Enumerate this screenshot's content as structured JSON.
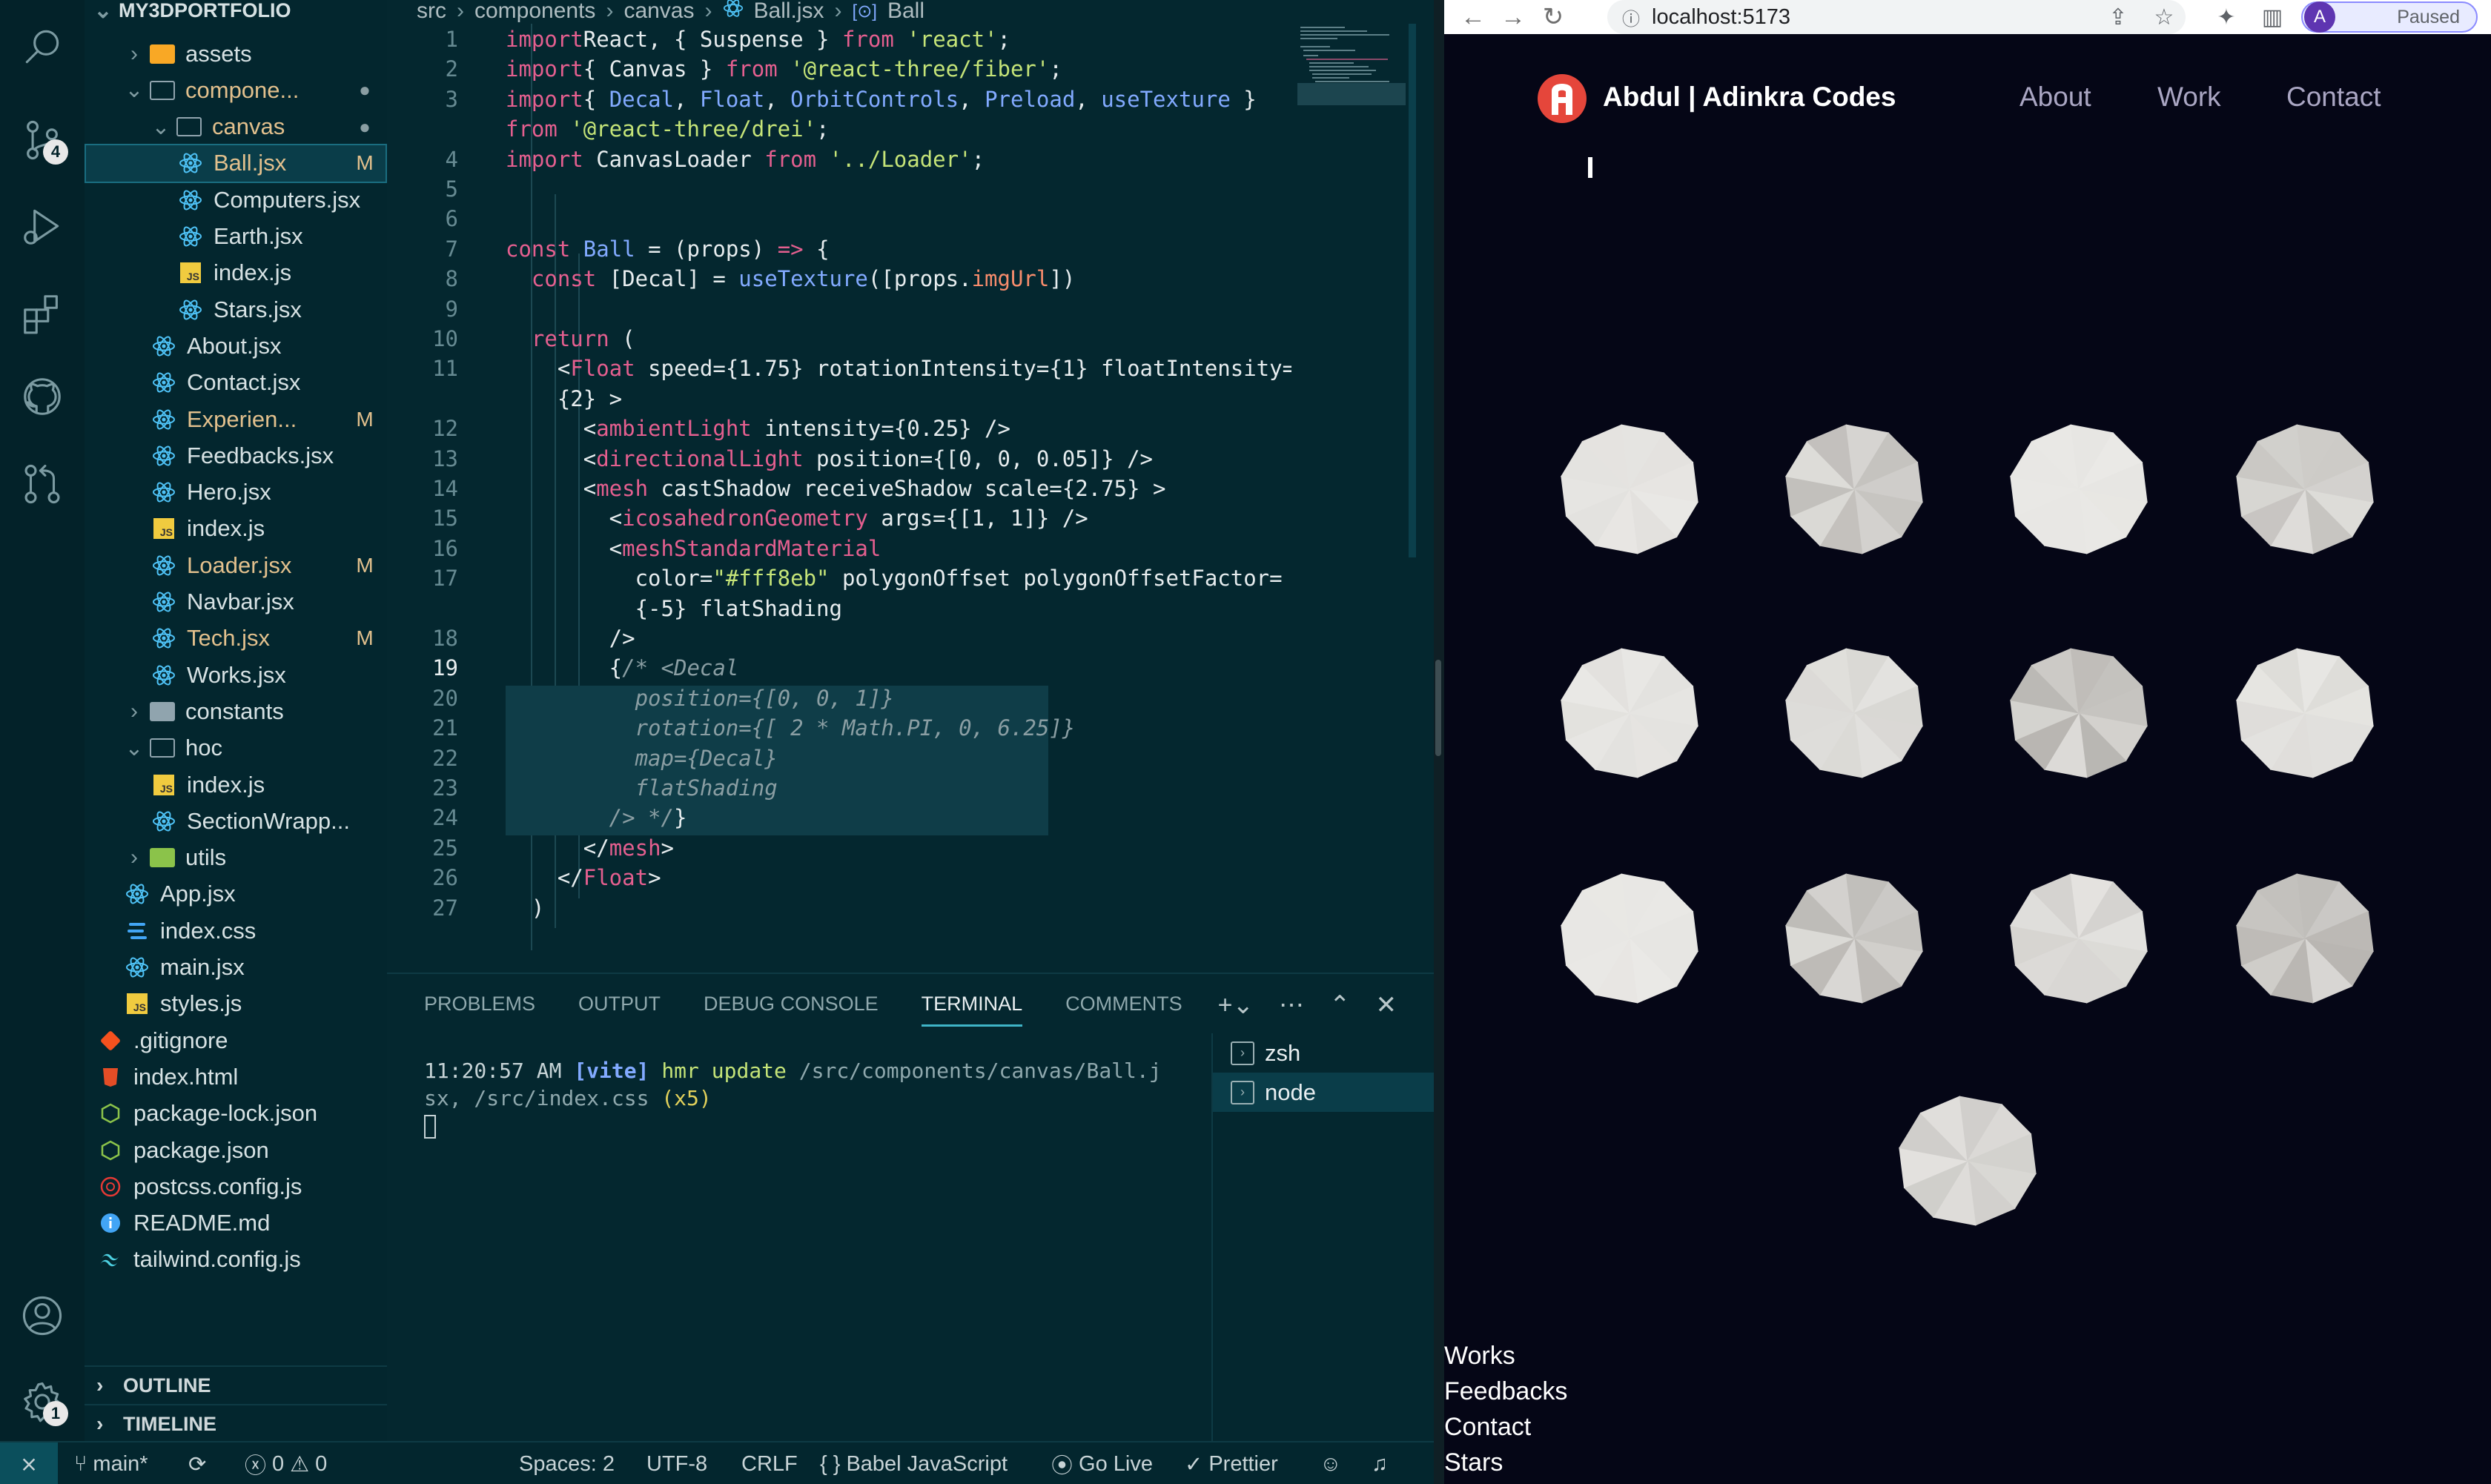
{
  "editor": {
    "breadcrumbs": [
      "src",
      "components",
      "canvas",
      "Ball.jsx",
      "Ball"
    ],
    "activity_badges": {
      "scm": "4",
      "settings": "1"
    }
  },
  "explorer": {
    "root": "MY3DPORTFOLIO",
    "tree": [
      {
        "name": "assets",
        "kind": "folder",
        "depth": 1,
        "chevron": "›"
      },
      {
        "name": "compone...",
        "kind": "folder-open",
        "depth": 1,
        "chevron": "⌄",
        "status": "●",
        "modified": true
      },
      {
        "name": "canvas",
        "kind": "folder-open",
        "depth": 2,
        "chevron": "⌄",
        "status": "●",
        "modified": true
      },
      {
        "name": "Ball.jsx",
        "kind": "react",
        "depth": 3,
        "status": "M",
        "modified": true,
        "selected": true
      },
      {
        "name": "Computers.jsx",
        "kind": "react",
        "depth": 3
      },
      {
        "name": "Earth.jsx",
        "kind": "react",
        "depth": 3
      },
      {
        "name": "index.js",
        "kind": "js",
        "depth": 3
      },
      {
        "name": "Stars.jsx",
        "kind": "react",
        "depth": 3
      },
      {
        "name": "About.jsx",
        "kind": "react",
        "depth": 2
      },
      {
        "name": "Contact.jsx",
        "kind": "react",
        "depth": 2
      },
      {
        "name": "Experien...",
        "kind": "react",
        "depth": 2,
        "status": "M",
        "modified": true
      },
      {
        "name": "Feedbacks.jsx",
        "kind": "react",
        "depth": 2
      },
      {
        "name": "Hero.jsx",
        "kind": "react",
        "depth": 2
      },
      {
        "name": "index.js",
        "kind": "js",
        "depth": 2
      },
      {
        "name": "Loader.jsx",
        "kind": "react",
        "depth": 2,
        "status": "M",
        "modified": true
      },
      {
        "name": "Navbar.jsx",
        "kind": "react",
        "depth": 2
      },
      {
        "name": "Tech.jsx",
        "kind": "react",
        "depth": 2,
        "status": "M",
        "modified": true
      },
      {
        "name": "Works.jsx",
        "kind": "react",
        "depth": 2
      },
      {
        "name": "constants",
        "kind": "folder",
        "depth": 1,
        "chevron": "›"
      },
      {
        "name": "hoc",
        "kind": "folder-open",
        "depth": 1,
        "chevron": "⌄"
      },
      {
        "name": "index.js",
        "kind": "js",
        "depth": 2
      },
      {
        "name": "SectionWrapp...",
        "kind": "react",
        "depth": 2
      },
      {
        "name": "utils",
        "kind": "folder",
        "depth": 1,
        "chevron": "›"
      },
      {
        "name": "App.jsx",
        "kind": "react",
        "depth": 1
      },
      {
        "name": "index.css",
        "kind": "css",
        "depth": 1
      },
      {
        "name": "main.jsx",
        "kind": "react",
        "depth": 1
      },
      {
        "name": "styles.js",
        "kind": "js",
        "depth": 1
      },
      {
        "name": ".gitignore",
        "kind": "git",
        "depth": 0
      },
      {
        "name": "index.html",
        "kind": "html",
        "depth": 0
      },
      {
        "name": "package-lock.json",
        "kind": "npm",
        "depth": 0
      },
      {
        "name": "package.json",
        "kind": "npm",
        "depth": 0
      },
      {
        "name": "postcss.config.js",
        "kind": "postcss",
        "depth": 0
      },
      {
        "name": "README.md",
        "kind": "info",
        "depth": 0
      },
      {
        "name": "tailwind.config.js",
        "kind": "tailwind",
        "depth": 0
      }
    ],
    "outline": "OUTLINE",
    "timeline": "TIMELINE"
  },
  "code": [
    {
      "n": "1",
      "tokens": [
        [
          "k",
          "import"
        ],
        [
          "",
          "React, { Suspense } "
        ],
        [
          "k",
          "from"
        ],
        [
          "s",
          " 'react'"
        ],
        [
          "",
          ";"
        ]
      ]
    },
    {
      "n": "2",
      "tokens": [
        [
          "k",
          "import"
        ],
        [
          "",
          ""
        ],
        [
          "",
          "{ Canvas } "
        ],
        [
          "k",
          "from"
        ],
        [
          "s",
          " '@react-three/fiber'"
        ],
        [
          "",
          ";"
        ]
      ]
    },
    {
      "n": "3",
      "tokens": [
        [
          "k",
          "import"
        ],
        [
          "",
          "{ "
        ],
        [
          "v",
          "Decal"
        ],
        [
          "",
          ", "
        ],
        [
          "v",
          "Float"
        ],
        [
          "",
          ", "
        ],
        [
          "v",
          "OrbitControls"
        ],
        [
          "",
          ", "
        ],
        [
          "v",
          "Preload"
        ],
        [
          "",
          ", "
        ],
        [
          "v",
          "useTexture"
        ],
        [
          "",
          " }"
        ]
      ]
    },
    {
      "n": "",
      "tokens": [
        [
          "k",
          "from"
        ],
        [
          "s",
          " '@react-three/drei'"
        ],
        [
          "",
          ";"
        ]
      ]
    },
    {
      "n": "4",
      "tokens": [
        [
          "k",
          "import"
        ],
        [
          "",
          " CanvasLoader "
        ],
        [
          "k",
          "from"
        ],
        [
          "s",
          " '../Loader'"
        ],
        [
          "",
          ";"
        ]
      ]
    },
    {
      "n": "5",
      "tokens": []
    },
    {
      "n": "6",
      "tokens": []
    },
    {
      "n": "7",
      "tokens": [
        [
          "k",
          "const"
        ],
        [
          "v",
          " Ball"
        ],
        [
          "",
          " = (props) "
        ],
        [
          "k",
          "=>"
        ],
        [
          "",
          " {"
        ]
      ]
    },
    {
      "n": "8",
      "tokens": [
        [
          "",
          "  "
        ],
        [
          "k",
          "const"
        ],
        [
          "",
          " [Decal] = "
        ],
        [
          "v",
          "useTexture"
        ],
        [
          "",
          "([props."
        ],
        [
          "n",
          "imgUrl"
        ],
        [
          "",
          "])"
        ]
      ]
    },
    {
      "n": "9",
      "tokens": []
    },
    {
      "n": "10",
      "tokens": [
        [
          "",
          "  "
        ],
        [
          "k",
          "return"
        ],
        [
          "",
          " ("
        ]
      ]
    },
    {
      "n": "11",
      "tokens": [
        [
          "",
          "    <"
        ],
        [
          "t",
          "Float"
        ],
        [
          "",
          " speed={1.75} rotationIntensity={1} floatIntensity="
        ]
      ]
    },
    {
      "n": "",
      "tokens": [
        [
          "",
          "    {2} >"
        ]
      ]
    },
    {
      "n": "12",
      "tokens": [
        [
          "",
          "      <"
        ],
        [
          "t",
          "ambientLight"
        ],
        [
          "",
          " intensity={0.25} />"
        ]
      ]
    },
    {
      "n": "13",
      "tokens": [
        [
          "",
          "      <"
        ],
        [
          "t",
          "directionalLight"
        ],
        [
          "",
          " position={[0, 0, 0.05]} />"
        ]
      ]
    },
    {
      "n": "14",
      "tokens": [
        [
          "",
          "      <"
        ],
        [
          "t",
          "mesh"
        ],
        [
          "",
          " castShadow receiveShadow scale={2.75} >"
        ]
      ]
    },
    {
      "n": "15",
      "tokens": [
        [
          "",
          "        <"
        ],
        [
          "t",
          "icosahedronGeometry"
        ],
        [
          "",
          " args={[1, 1]} />"
        ]
      ]
    },
    {
      "n": "16",
      "tokens": [
        [
          "",
          "        <"
        ],
        [
          "t",
          "meshStandardMaterial"
        ]
      ]
    },
    {
      "n": "17",
      "tokens": [
        [
          "",
          "          color="
        ],
        [
          "s",
          "\"#fff8eb\""
        ],
        [
          "",
          " polygonOffset polygonOffsetFactor="
        ]
      ]
    },
    {
      "n": "",
      "tokens": [
        [
          "",
          "          {-5} flatShading"
        ]
      ]
    },
    {
      "n": "18",
      "tokens": [
        [
          "",
          "        />"
        ]
      ]
    },
    {
      "n": "19",
      "tokens": [
        [
          "",
          "        {"
        ],
        [
          "c",
          "/* <Decal"
        ]
      ]
    },
    {
      "n": "20",
      "tokens": [
        [
          "c",
          "          position={[0, 0, 1]}"
        ]
      ]
    },
    {
      "n": "21",
      "tokens": [
        [
          "c",
          "          rotation={[ 2 * Math.PI, 0, 6.25]}"
        ]
      ]
    },
    {
      "n": "22",
      "tokens": [
        [
          "c",
          "          map={Decal}"
        ]
      ]
    },
    {
      "n": "23",
      "tokens": [
        [
          "c",
          "          flatShading"
        ]
      ]
    },
    {
      "n": "24",
      "tokens": [
        [
          "c",
          "        /> */"
        ],
        [
          "",
          "}"
        ]
      ]
    },
    {
      "n": "25",
      "tokens": [
        [
          "",
          "      </"
        ],
        [
          "t",
          "mesh"
        ],
        [
          "",
          ">"
        ]
      ]
    },
    {
      "n": "26",
      "tokens": [
        [
          "",
          "    </"
        ],
        [
          "t",
          "Float"
        ],
        [
          "",
          ">"
        ]
      ]
    },
    {
      "n": "27",
      "tokens": [
        [
          "",
          "  )"
        ]
      ]
    }
  ],
  "panel": {
    "tabs": [
      "PROBLEMS",
      "OUTPUT",
      "DEBUG CONSOLE",
      "TERMINAL",
      "COMMENTS"
    ],
    "active_tab": "TERMINAL",
    "terminal_time": "11:20:57 AM",
    "terminal_tag": "[vite]",
    "terminal_msg": "hmr update",
    "terminal_path1": "/src/components/canvas/Ball.j",
    "terminal_path2": "sx, /src/index.css",
    "terminal_count": "(x5)",
    "terminals": [
      "zsh",
      "node"
    ],
    "active_terminal": "node"
  },
  "statusbar": {
    "branch": "main*",
    "errors": "0",
    "warnings": "0",
    "spaces": "Spaces: 2",
    "encoding": "UTF-8",
    "eol": "CRLF",
    "language": "Babel JavaScript",
    "golive": "Go Live",
    "prettier": "Prettier"
  },
  "browser": {
    "url": "localhost:5173",
    "profile_initial": "A",
    "profile_status": "Paused",
    "brand": "Abdul | Adinkra Codes",
    "nav": [
      "About",
      "Work",
      "Contact"
    ],
    "footer_links": [
      "Works",
      "Feedbacks",
      "Contact",
      "Stars"
    ],
    "balls": [
      {
        "row": 0,
        "col": 0,
        "shade": 0.1
      },
      {
        "row": 0,
        "col": 1,
        "shade": 0.45
      },
      {
        "row": 0,
        "col": 2,
        "shade": 0.05
      },
      {
        "row": 0,
        "col": 3,
        "shade": 0.4
      },
      {
        "row": 1,
        "col": 0,
        "shade": 0.1
      },
      {
        "row": 1,
        "col": 1,
        "shade": 0.2
      },
      {
        "row": 1,
        "col": 2,
        "shade": 0.55
      },
      {
        "row": 1,
        "col": 3,
        "shade": 0.15
      },
      {
        "row": 2,
        "col": 0,
        "shade": 0.05
      },
      {
        "row": 2,
        "col": 1,
        "shade": 0.5
      },
      {
        "row": 2,
        "col": 2,
        "shade": 0.25
      },
      {
        "row": 2,
        "col": 3,
        "shade": 0.55
      },
      {
        "row": 3,
        "col": 1.5,
        "shade": 0.3
      }
    ]
  },
  "colors": {
    "editor_bg": "#04272f",
    "ball_light": "#ecebe8",
    "ball_dark": "#8f8b86",
    "logo_red": "#e5463b"
  }
}
